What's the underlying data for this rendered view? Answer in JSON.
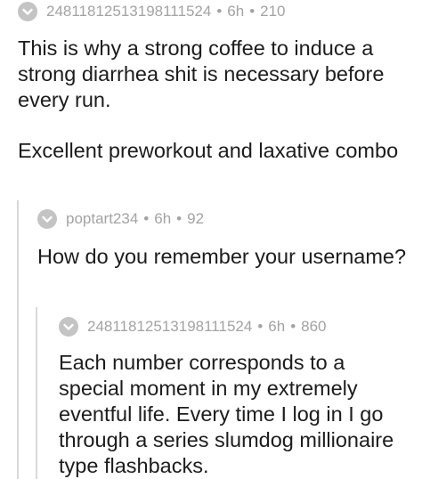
{
  "comments": [
    {
      "username": "24811812513198111524",
      "age": "6h",
      "score": "210",
      "separator": "•",
      "paragraphs": [
        "This is why a strong coffee to induce a strong diarrhea shit is necessary before every run.",
        "Excellent preworkout and laxative combo"
      ]
    },
    {
      "username": "poptart234",
      "age": "6h",
      "score": "92",
      "separator": "•",
      "paragraphs": [
        "How do you remember your username?"
      ]
    },
    {
      "username": "24811812513198111524",
      "age": "6h",
      "score": "860",
      "separator": "•",
      "paragraphs": [
        "Each number corresponds to a special moment in my extremely eventful life. Every time I log in I go through a series slumdog millionaire type flashbacks."
      ]
    }
  ],
  "icons": {
    "collapse": "chevron-down-circle-icon"
  },
  "colors": {
    "meta_text": "#a3a3a3",
    "icon_fill": "#c4c4c4",
    "thread_line": "#d9d9d9",
    "body_text": "#1c1c1c"
  }
}
